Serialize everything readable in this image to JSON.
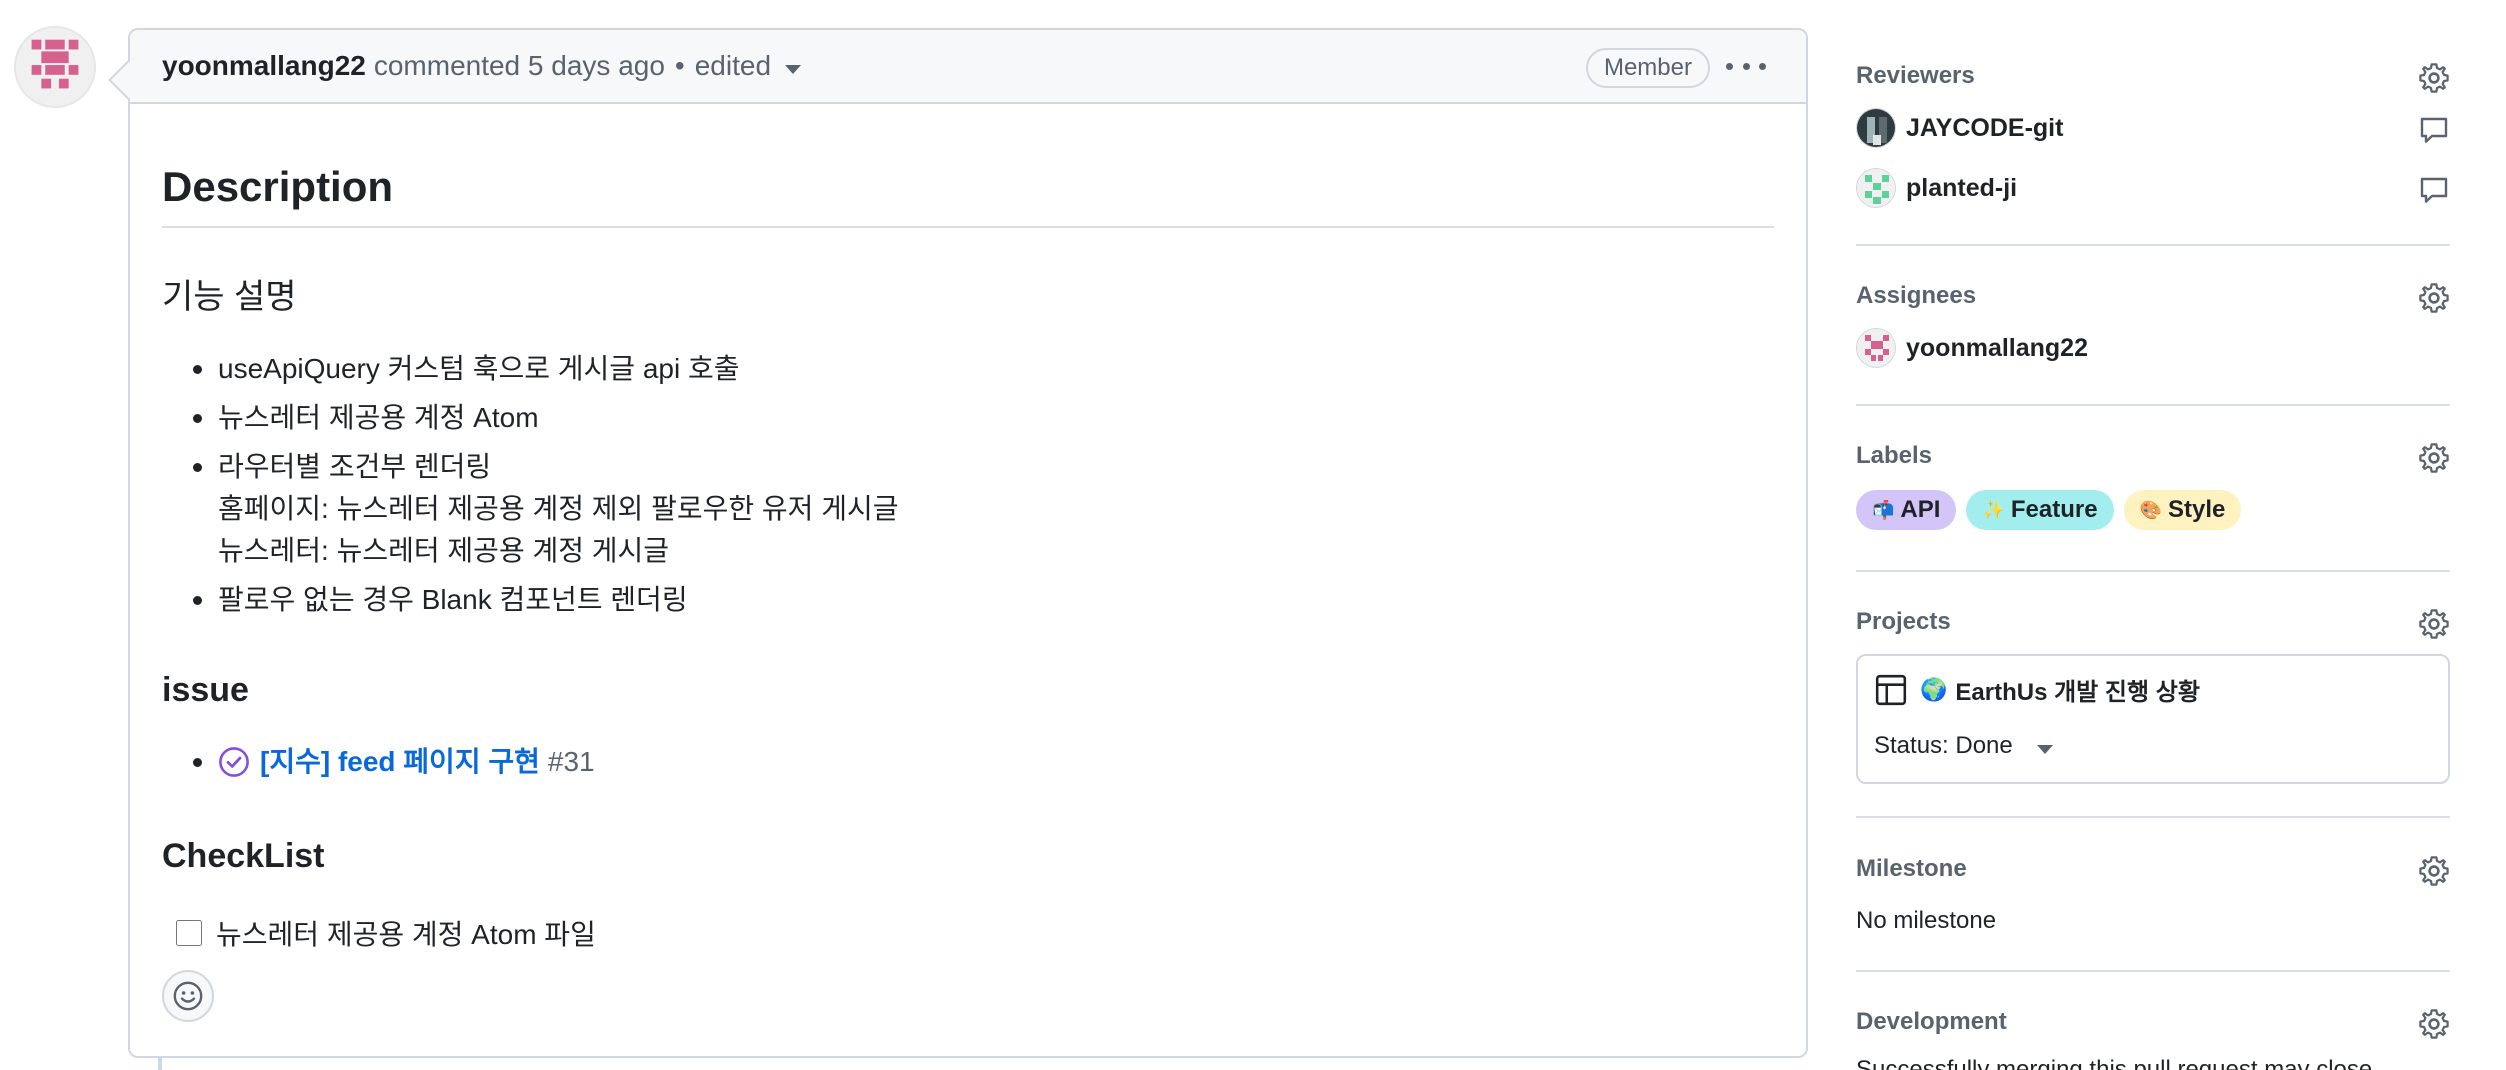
{
  "comment": {
    "author": "yoonmallang22",
    "action": "commented",
    "time": "5 days ago",
    "separator": "•",
    "edited": "edited",
    "badge": "Member",
    "body": {
      "title": "Description",
      "section1_title": "기능 설명",
      "items": [
        "useApiQuery 커스텀 훅으로 게시글 api 호출",
        "뉴스레터 제공용 계정 Atom",
        "라우터별 조건부 렌더링",
        "홈페이지: 뉴스레터 제공용 계정 제외 팔로우한 유저 게시글",
        "뉴스레터: 뉴스레터 제공용 계정 게시글",
        "팔로우 없는 경우 Blank 컴포넌트 렌더링"
      ],
      "section2_title": "issue",
      "issue": {
        "title": "[지수] feed 페이지 구현",
        "number": "#31",
        "icon": "check-circle-icon"
      },
      "section3_title": "CheckList",
      "checklist": [
        {
          "label": "뉴스레터 제공용 계정 Atom 파일",
          "checked": false
        }
      ]
    }
  },
  "sidebar": {
    "reviewers": {
      "title": "Reviewers",
      "people": [
        {
          "name": "JAYCODE-git"
        },
        {
          "name": "planted-ji"
        }
      ]
    },
    "assignees": {
      "title": "Assignees",
      "people": [
        {
          "name": "yoonmallang22"
        }
      ]
    },
    "labels": {
      "title": "Labels",
      "items": [
        {
          "emoji": "📬",
          "text": "API",
          "color": "#d4c5f9"
        },
        {
          "emoji": "✨",
          "text": "Feature",
          "color": "#a2eeef"
        },
        {
          "emoji": "🎨",
          "text": "Style",
          "color": "#fef2c0"
        }
      ]
    },
    "projects": {
      "title": "Projects",
      "globe": "🌍",
      "name": "EarthUs 개발 진행 상황",
      "status": "Status: Done"
    },
    "milestone": {
      "title": "Milestone",
      "value": "No milestone"
    },
    "development": {
      "title": "Development",
      "value": "Successfully merging this pull request may close"
    }
  },
  "colors": {
    "link": "#0969da",
    "muted": "#59636e",
    "border": "#d0d7de",
    "issue_closed": "#8250df"
  }
}
